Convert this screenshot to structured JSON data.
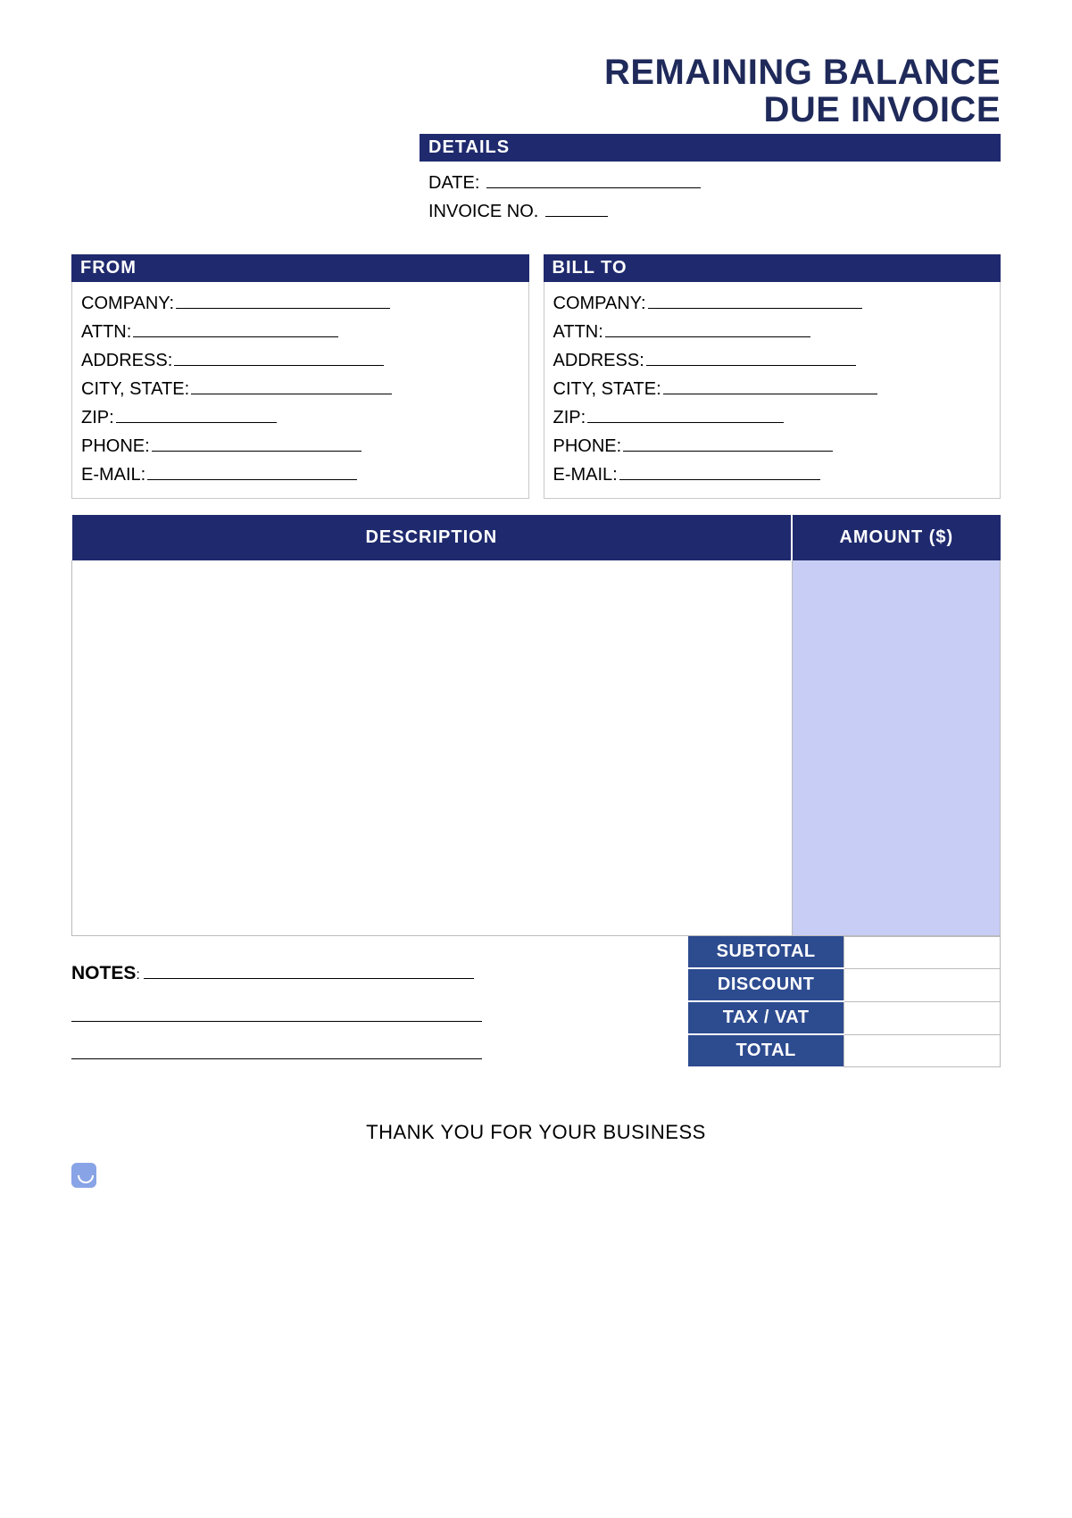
{
  "title_line1": "REMAINING BALANCE",
  "title_line2": "DUE INVOICE",
  "details": {
    "header": "DETAILS",
    "date_label": "DATE:",
    "invoice_label": "INVOICE NO."
  },
  "from": {
    "header": "FROM",
    "company_label": "COMPANY:",
    "attn_label": "ATTN:",
    "address_label": "ADDRESS:",
    "citystate_label": "CITY, STATE:",
    "zip_label": "ZIP:",
    "phone_label": "PHONE:",
    "email_label": "E-MAIL:"
  },
  "billto": {
    "header": "BILL TO",
    "company_label": "COMPANY:",
    "attn_label": "ATTN:",
    "address_label": "ADDRESS:",
    "citystate_label": "CITY, STATE:",
    "zip_label": "ZIP:",
    "phone_label": "PHONE:",
    "email_label": "E-MAIL:"
  },
  "table": {
    "description_header": "DESCRIPTION",
    "amount_header": "AMOUNT ($)"
  },
  "notes_label": "NOTES",
  "notes_colon": ":",
  "totals": {
    "subtotal": "SUBTOTAL",
    "discount": "DISCOUNT",
    "taxvat": "TAX / VAT",
    "total": "TOTAL"
  },
  "thank_you": "THANK YOU FOR YOUR BUSINESS"
}
